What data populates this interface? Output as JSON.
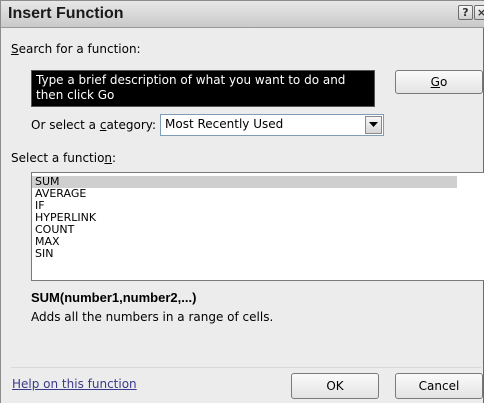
{
  "window": {
    "title": "Insert Function",
    "help_glyph": "?",
    "close_glyph": "×"
  },
  "search": {
    "label_prefix": "",
    "label_accel": "S",
    "label_rest": "earch for a function:",
    "value": "Type a brief description of what you want to do and then click Go",
    "go_accel": "G",
    "go_rest": "o"
  },
  "category": {
    "label_prefix": "Or select a ",
    "label_accel": "c",
    "label_rest": "ategory:",
    "selected": "Most Recently Used",
    "arrow_icon": "chevron-down-icon"
  },
  "functions": {
    "label_prefix": "Select a functio",
    "label_accel": "n",
    "label_rest": ":",
    "items": [
      "SUM",
      "AVERAGE",
      "IF",
      "HYPERLINK",
      "COUNT",
      "MAX",
      "SIN"
    ],
    "selected_index": 0
  },
  "details": {
    "signature": "SUM(number1,number2,...)",
    "description": "Adds all the numbers in a range of cells."
  },
  "footer": {
    "help_link": "Help on this function",
    "ok": "OK",
    "cancel": "Cancel"
  },
  "colors": {
    "window_bg": "#ececec",
    "search_bg": "#000000",
    "search_text": "#ffffff",
    "selected_row": "#cfcfcf",
    "link": "#3a3a8a"
  }
}
